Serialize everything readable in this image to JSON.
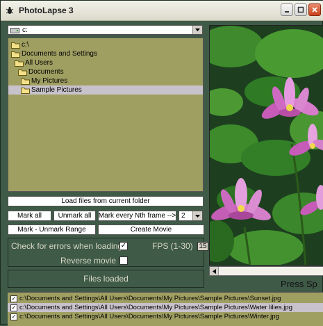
{
  "window": {
    "title": "PhotoLapse 3"
  },
  "drive_select": {
    "value": "c:"
  },
  "folder_tree": {
    "items": [
      {
        "label": "c:\\"
      },
      {
        "label": "Documents and Settings"
      },
      {
        "label": "All Users"
      },
      {
        "label": "Documents"
      },
      {
        "label": "My Pictures"
      },
      {
        "label": "Sample Pictures"
      }
    ]
  },
  "buttons": {
    "load_files": "Load files from current folder",
    "mark_all": "Mark all",
    "unmark_all": "Unmark all",
    "mark_every_nth": "Mark every Nth frame -->",
    "mark_unmark_range": "Mark - Unmark Range",
    "create_movie": "Create Movie"
  },
  "nth_select": {
    "value": "2"
  },
  "options": {
    "check_errors_label": "Check for errors when loading",
    "check_errors_checked": "✓",
    "fps_label": "FPS (1-30)",
    "fps_value": "15",
    "reverse_label": "Reverse movie"
  },
  "status": {
    "text": "Files loaded"
  },
  "preview": {
    "press_text": "Press Sp"
  },
  "files": [
    {
      "path": "c:\\Documents and Settings\\All Users\\Documents\\My Pictures\\Sample Pictures\\Sunset.jpg",
      "checked": "✓"
    },
    {
      "path": "c:\\Documents and Settings\\All Users\\Documents\\My Pictures\\Sample Pictures\\Water lilies.jpg",
      "checked": "✓"
    },
    {
      "path": "c:\\Documents and Settings\\All Users\\Documents\\My Pictures\\Sample Pictures\\Winter.jpg",
      "checked": "✓"
    }
  ],
  "colors": {
    "window_bg": "#3f5a47",
    "tree_bg": "#a09f62",
    "selection": "#c7c2cb",
    "label_text": "#d8d9c7"
  }
}
